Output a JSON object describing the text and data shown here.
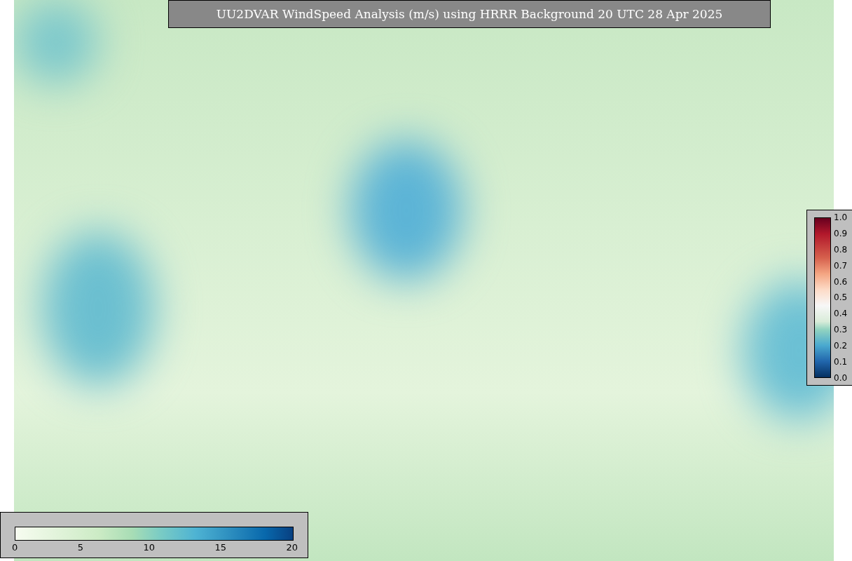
{
  "title": "UU2DVAR WindSpeed Analysis (m/s) using HRRR Background 20 UTC 28 Apr 2025",
  "ratio_colorbar": {
    "ticks": [
      "1.0",
      "0.9",
      "0.8",
      "0.7",
      "0.6",
      "0.5",
      "0.4",
      "0.3",
      "0.2",
      "0.1",
      "0.0"
    ]
  },
  "wind_colorbar": {
    "ticks": [
      "0",
      "5",
      "10",
      "15",
      "20"
    ]
  }
}
